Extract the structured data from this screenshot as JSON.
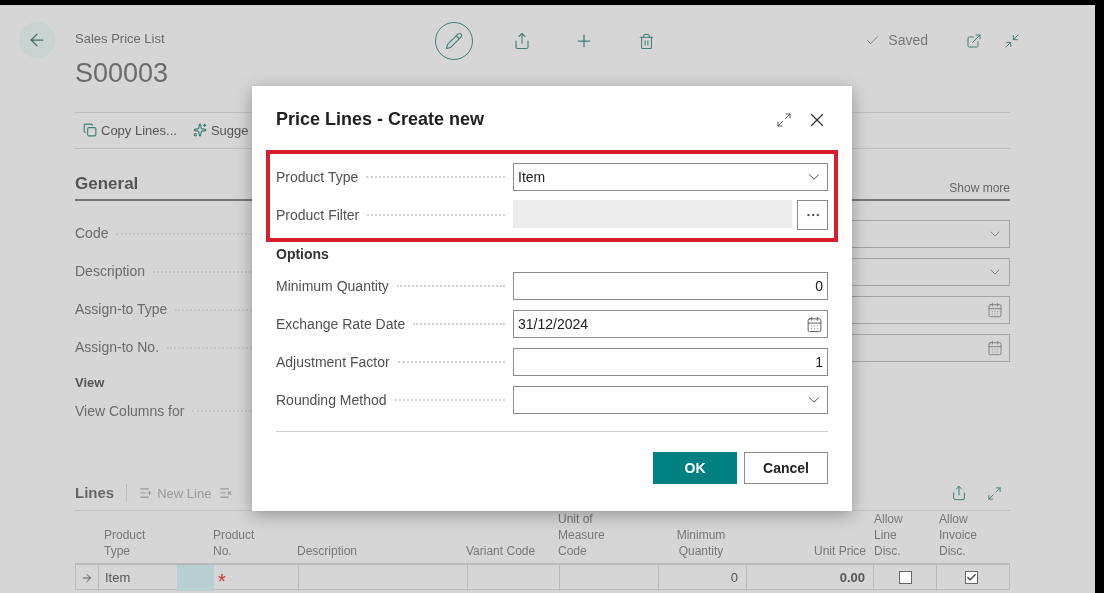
{
  "header": {
    "breadcrumb": "Sales Price List",
    "title": "S00003",
    "status": "Saved",
    "edit_selected": true
  },
  "action_bar": [
    "Copy Lines...",
    "Sugge"
  ],
  "general": {
    "title": "General",
    "show_more": "Show more",
    "fields": [
      {
        "label": "Code"
      },
      {
        "label": "Description"
      },
      {
        "label": "Assign-to Type"
      },
      {
        "label": "Assign-to No."
      }
    ],
    "right_fields": [
      {
        "kind": "dropdown"
      },
      {
        "kind": "dropdown"
      },
      {
        "kind": "date"
      },
      {
        "kind": "date"
      }
    ]
  },
  "view": {
    "title": "View",
    "fields": [
      {
        "label": "View Columns for"
      }
    ]
  },
  "lines": {
    "title": "Lines",
    "actions": [
      "New Line"
    ],
    "columns": [
      "Product Type",
      "Product No.",
      "Description",
      "Variant Code",
      "Unit of Measure Code",
      "Minimum Quantity",
      "Unit Price",
      "Allow Line Disc.",
      "Allow Invoice Disc."
    ],
    "rows": [
      {
        "product_type": "Item",
        "product_no_required": "*",
        "minimum_quantity": "0",
        "unit_price": "0.00",
        "allow_line_disc": false,
        "allow_invoice_disc": true
      }
    ]
  },
  "dialog": {
    "title": "Price Lines - Create new",
    "highlighted_fields": [
      {
        "label": "Product Type",
        "kind": "dropdown",
        "value": "Item"
      },
      {
        "label": "Product Filter",
        "kind": "lookup",
        "disabled": true
      }
    ],
    "options_title": "Options",
    "options": [
      {
        "label": "Minimum Quantity",
        "kind": "number",
        "value": "0"
      },
      {
        "label": "Exchange Rate Date",
        "kind": "date",
        "value": "31/12/2024"
      },
      {
        "label": "Adjustment Factor",
        "kind": "number",
        "value": "1"
      },
      {
        "label": "Rounding Method",
        "kind": "dropdown"
      }
    ],
    "buttons": [
      {
        "label": "OK",
        "kind": "primary"
      },
      {
        "label": "Cancel",
        "kind": "secondary"
      }
    ]
  }
}
